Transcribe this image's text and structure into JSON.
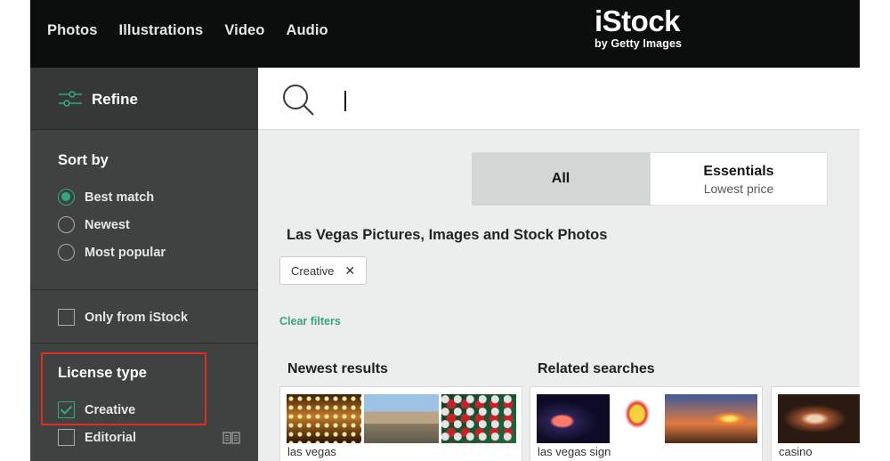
{
  "header": {
    "nav": [
      "Photos",
      "Illustrations",
      "Video",
      "Audio"
    ],
    "logo": {
      "brand": "iStock",
      "tagline": "by Getty Images"
    }
  },
  "sidebar": {
    "refine_label": "Refine",
    "sort_by": {
      "title": "Sort by",
      "options": [
        {
          "label": "Best match",
          "selected": true
        },
        {
          "label": "Newest",
          "selected": false
        },
        {
          "label": "Most popular",
          "selected": false
        }
      ]
    },
    "only_from_istock": {
      "label": "Only from iStock",
      "checked": false
    },
    "license_type": {
      "title": "License type",
      "options": [
        {
          "label": "Creative",
          "checked": true
        },
        {
          "label": "Editorial",
          "checked": false
        }
      ]
    }
  },
  "search": {
    "value": ""
  },
  "tabs": [
    {
      "label": "All",
      "sublabel": "",
      "active": true
    },
    {
      "label": "Essentials",
      "sublabel": "Lowest price",
      "active": false
    }
  ],
  "results": {
    "title": "Las Vegas Pictures, Images and Stock Photos",
    "filter_chip": "Creative",
    "clear_filters": "Clear filters",
    "newest_heading": "Newest results",
    "related_heading": "Related searches",
    "cards": [
      {
        "label": "las vegas"
      },
      {
        "label": "las vegas sign"
      },
      {
        "label": "casino"
      }
    ]
  },
  "colors": {
    "accent": "#2faa84",
    "highlight_box": "#e02b1e",
    "topbar": "#0c0d0d",
    "sidebar": "#3f4241"
  }
}
